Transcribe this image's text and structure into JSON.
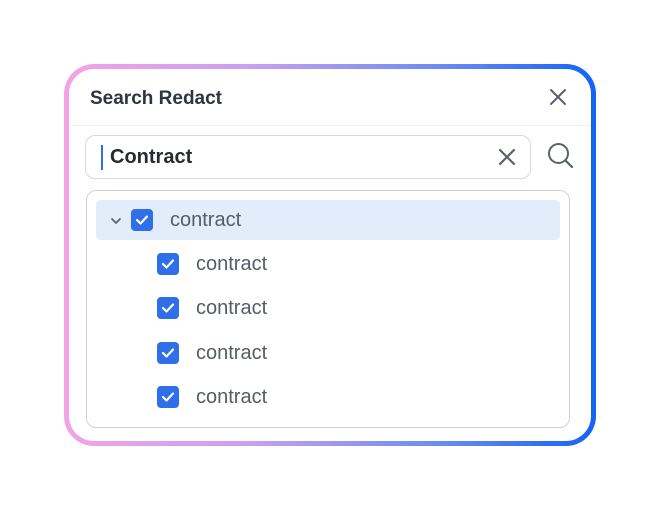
{
  "dialog": {
    "title": "Search Redact"
  },
  "search": {
    "value": "Contract",
    "placeholder": ""
  },
  "results": {
    "parent": {
      "label": "contract",
      "checked": true,
      "expanded": true
    },
    "children": [
      {
        "label": "contract",
        "checked": true
      },
      {
        "label": "contract",
        "checked": true
      },
      {
        "label": "contract",
        "checked": true
      },
      {
        "label": "contract",
        "checked": true
      }
    ]
  },
  "colors": {
    "accent": "#2f6fe9",
    "row_highlight": "#e3ecfb",
    "gradient_start": "#f3a3e6",
    "gradient_end": "#1363f4"
  },
  "icons": [
    "close-icon",
    "clear-icon",
    "search-icon",
    "chevron-down-icon",
    "checkmark-icon"
  ]
}
